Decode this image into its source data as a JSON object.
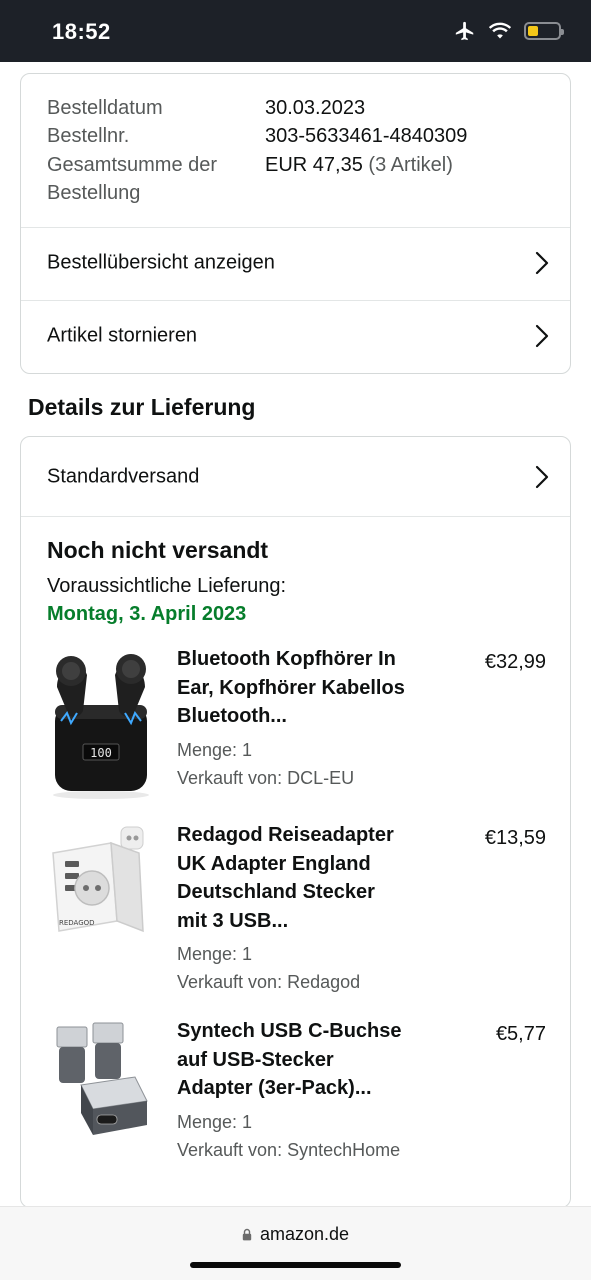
{
  "status_bar": {
    "time": "18:52",
    "icons": [
      "airplane-icon",
      "wifi-icon",
      "battery-icon"
    ],
    "battery_level": 0.35,
    "battery_color": "#f4c81a"
  },
  "order_summary": {
    "date_label": "Bestelldatum",
    "date_value": "30.03.2023",
    "number_label": "Bestellnr.",
    "number_value": "303-5633461-4840309",
    "total_label_line1": "Gesamtsumme der",
    "total_label_line2": "Bestellung",
    "total_value": "EUR 47,35",
    "total_items": "(3 Artikel)",
    "links": [
      {
        "label": "Bestellübersicht anzeigen"
      },
      {
        "label": "Artikel stornieren"
      }
    ]
  },
  "delivery": {
    "section_title": "Details zur Lieferung",
    "shipping_method": "Standardversand",
    "status": "Noch nicht versandt",
    "eta_label": "Voraussichtliche Lieferung:",
    "eta_date": "Montag, 3. April 2023",
    "eta_color": "#067d2b",
    "items": [
      {
        "title_lines": [
          "Bluetooth Kopfhörer In",
          "Ear, Kopfhörer Kabellos",
          "Bluetooth..."
        ],
        "price": "€32,99",
        "quantity": "Menge: 1",
        "seller": "Verkauft von: DCL-EU",
        "image": "earbuds-image"
      },
      {
        "title_lines": [
          "Redagod Reiseadapter",
          "UK Adapter England",
          "Deutschland Stecker",
          "mit 3 USB..."
        ],
        "price": "€13,59",
        "quantity": "Menge: 1",
        "seller": "Verkauft von: Redagod",
        "image": "travel-adapter-image"
      },
      {
        "title_lines": [
          "Syntech USB C-Buchse",
          "auf USB-Stecker",
          "Adapter (3er-Pack)..."
        ],
        "price": "€5,77",
        "quantity": "Menge: 1",
        "seller": "Verkauft von: SyntechHome",
        "image": "usb-adapter-image"
      }
    ]
  },
  "browser": {
    "url": "amazon.de",
    "icon": "lock-icon"
  }
}
